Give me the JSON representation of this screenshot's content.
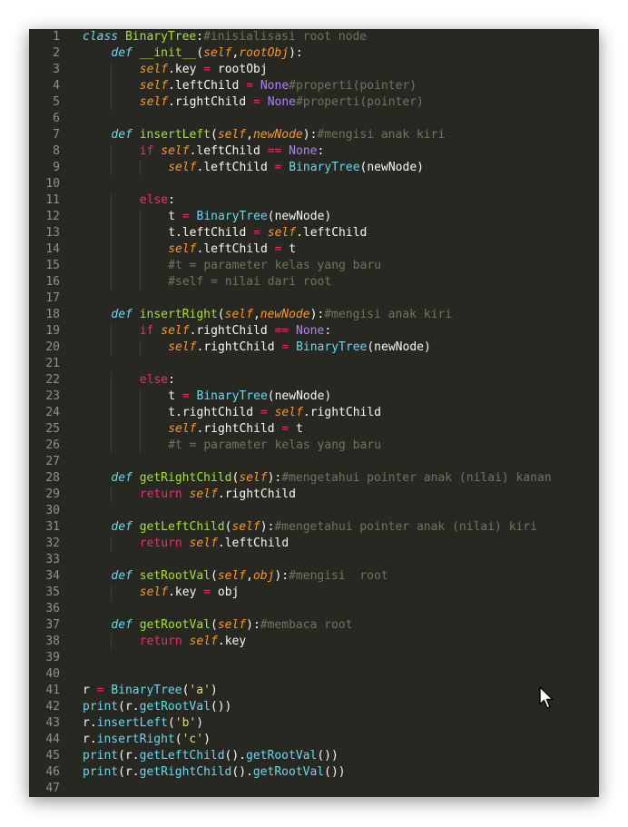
{
  "editor": {
    "theme_colors": {
      "background": "#272822",
      "keyword": "#f92672",
      "function": "#a6e22e",
      "class": "#66d9ef",
      "comment": "#75715e",
      "self": "#fd971f",
      "constant": "#ae81ff",
      "string": "#e6db74",
      "text": "#f8f8f2"
    },
    "lines": [
      {
        "n": "1",
        "indent": 0,
        "tokens": [
          [
            "kw-def",
            "class"
          ],
          [
            "",
            " "
          ],
          [
            "fn",
            "BinaryTree"
          ],
          [
            "",
            ":"
          ],
          [
            "cmt",
            "#inisialisasi root node"
          ]
        ]
      },
      {
        "n": "2",
        "indent": 1,
        "tokens": [
          [
            "kw-def",
            "def"
          ],
          [
            "",
            " "
          ],
          [
            "fn",
            "__init__"
          ],
          [
            "",
            "("
          ],
          [
            "self",
            "self"
          ],
          [
            "",
            ","
          ],
          [
            "param",
            "rootObj"
          ],
          [
            "",
            "):"
          ]
        ]
      },
      {
        "n": "3",
        "indent": 2,
        "tokens": [
          [
            "self",
            "self"
          ],
          [
            "",
            ".key "
          ],
          [
            "op",
            "="
          ],
          [
            "",
            " rootObj"
          ]
        ]
      },
      {
        "n": "4",
        "indent": 2,
        "tokens": [
          [
            "self",
            "self"
          ],
          [
            "",
            ".leftChild "
          ],
          [
            "op",
            "="
          ],
          [
            "",
            " "
          ],
          [
            "const",
            "None"
          ],
          [
            "cmt",
            "#properti(pointer)"
          ]
        ]
      },
      {
        "n": "5",
        "indent": 2,
        "tokens": [
          [
            "self",
            "self"
          ],
          [
            "",
            ".rightChild "
          ],
          [
            "op",
            "="
          ],
          [
            "",
            " "
          ],
          [
            "const",
            "None"
          ],
          [
            "cmt",
            "#properti(pointer)"
          ]
        ]
      },
      {
        "n": "6",
        "indent": 0,
        "tokens": []
      },
      {
        "n": "7",
        "indent": 1,
        "tokens": [
          [
            "kw-def",
            "def"
          ],
          [
            "",
            " "
          ],
          [
            "fn",
            "insertLeft"
          ],
          [
            "",
            "("
          ],
          [
            "self",
            "self"
          ],
          [
            "",
            ","
          ],
          [
            "param",
            "newNode"
          ],
          [
            "",
            "):"
          ],
          [
            "cmt",
            "#mengisi anak kiri"
          ]
        ]
      },
      {
        "n": "8",
        "indent": 2,
        "tokens": [
          [
            "kw",
            "if"
          ],
          [
            "",
            " "
          ],
          [
            "self",
            "self"
          ],
          [
            "",
            ".leftChild "
          ],
          [
            "op",
            "=="
          ],
          [
            "",
            " "
          ],
          [
            "const",
            "None"
          ],
          [
            "",
            ":"
          ]
        ]
      },
      {
        "n": "9",
        "indent": 3,
        "tokens": [
          [
            "self",
            "self"
          ],
          [
            "",
            ".leftChild "
          ],
          [
            "op",
            "="
          ],
          [
            "",
            " "
          ],
          [
            "cls",
            "BinaryTree"
          ],
          [
            "",
            "(newNode)"
          ]
        ]
      },
      {
        "n": "10",
        "indent": 0,
        "tokens": []
      },
      {
        "n": "11",
        "indent": 2,
        "tokens": [
          [
            "kw",
            "else"
          ],
          [
            "",
            ":"
          ]
        ]
      },
      {
        "n": "12",
        "indent": 3,
        "tokens": [
          [
            "",
            "t "
          ],
          [
            "op",
            "="
          ],
          [
            "",
            " "
          ],
          [
            "cls",
            "BinaryTree"
          ],
          [
            "",
            "(newNode)"
          ]
        ]
      },
      {
        "n": "13",
        "indent": 3,
        "tokens": [
          [
            "",
            "t.leftChild "
          ],
          [
            "op",
            "="
          ],
          [
            "",
            " "
          ],
          [
            "self",
            "self"
          ],
          [
            "",
            ".leftChild"
          ]
        ]
      },
      {
        "n": "14",
        "indent": 3,
        "tokens": [
          [
            "self",
            "self"
          ],
          [
            "",
            ".leftChild "
          ],
          [
            "op",
            "="
          ],
          [
            "",
            " t"
          ]
        ]
      },
      {
        "n": "15",
        "indent": 3,
        "tokens": [
          [
            "cmt",
            "#t = parameter kelas yang baru"
          ]
        ]
      },
      {
        "n": "16",
        "indent": 3,
        "tokens": [
          [
            "cmt",
            "#self = nilai dari root"
          ]
        ]
      },
      {
        "n": "17",
        "indent": 0,
        "tokens": []
      },
      {
        "n": "18",
        "indent": 1,
        "tokens": [
          [
            "kw-def",
            "def"
          ],
          [
            "",
            " "
          ],
          [
            "fn",
            "insertRight"
          ],
          [
            "",
            "("
          ],
          [
            "self",
            "self"
          ],
          [
            "",
            ","
          ],
          [
            "param",
            "newNode"
          ],
          [
            "",
            "):"
          ],
          [
            "cmt",
            "#mengisi anak kiri"
          ]
        ]
      },
      {
        "n": "19",
        "indent": 2,
        "tokens": [
          [
            "kw",
            "if"
          ],
          [
            "",
            " "
          ],
          [
            "self",
            "self"
          ],
          [
            "",
            ".rightChild "
          ],
          [
            "op",
            "=="
          ],
          [
            "",
            " "
          ],
          [
            "const",
            "None"
          ],
          [
            "",
            ":"
          ]
        ]
      },
      {
        "n": "20",
        "indent": 3,
        "tokens": [
          [
            "self",
            "self"
          ],
          [
            "",
            ".rightChild "
          ],
          [
            "op",
            "="
          ],
          [
            "",
            " "
          ],
          [
            "cls",
            "BinaryTree"
          ],
          [
            "",
            "(newNode)"
          ]
        ]
      },
      {
        "n": "21",
        "indent": 0,
        "tokens": []
      },
      {
        "n": "22",
        "indent": 2,
        "tokens": [
          [
            "kw",
            "else"
          ],
          [
            "",
            ":"
          ]
        ]
      },
      {
        "n": "23",
        "indent": 3,
        "tokens": [
          [
            "",
            "t "
          ],
          [
            "op",
            "="
          ],
          [
            "",
            " "
          ],
          [
            "cls",
            "BinaryTree"
          ],
          [
            "",
            "(newNode)"
          ]
        ]
      },
      {
        "n": "24",
        "indent": 3,
        "tokens": [
          [
            "",
            "t.rightChild "
          ],
          [
            "op",
            "="
          ],
          [
            "",
            " "
          ],
          [
            "self",
            "self"
          ],
          [
            "",
            ".rightChild"
          ]
        ]
      },
      {
        "n": "25",
        "indent": 3,
        "tokens": [
          [
            "self",
            "self"
          ],
          [
            "",
            ".rightChild "
          ],
          [
            "op",
            "="
          ],
          [
            "",
            " t"
          ]
        ]
      },
      {
        "n": "26",
        "indent": 3,
        "tokens": [
          [
            "cmt",
            "#t = parameter kelas yang baru"
          ]
        ]
      },
      {
        "n": "27",
        "indent": 0,
        "tokens": []
      },
      {
        "n": "28",
        "indent": 1,
        "tokens": [
          [
            "kw-def",
            "def"
          ],
          [
            "",
            " "
          ],
          [
            "fn",
            "getRightChild"
          ],
          [
            "",
            "("
          ],
          [
            "self",
            "self"
          ],
          [
            "",
            "):"
          ],
          [
            "cmt",
            "#mengetahui pointer anak (nilai) kanan"
          ]
        ]
      },
      {
        "n": "29",
        "indent": 2,
        "tokens": [
          [
            "kw",
            "return"
          ],
          [
            "",
            " "
          ],
          [
            "self",
            "self"
          ],
          [
            "",
            ".rightChild"
          ]
        ]
      },
      {
        "n": "30",
        "indent": 0,
        "tokens": []
      },
      {
        "n": "31",
        "indent": 1,
        "tokens": [
          [
            "kw-def",
            "def"
          ],
          [
            "",
            " "
          ],
          [
            "fn",
            "getLeftChild"
          ],
          [
            "",
            "("
          ],
          [
            "self",
            "self"
          ],
          [
            "",
            "):"
          ],
          [
            "cmt",
            "#mengetahui pointer anak (nilai) kiri"
          ]
        ]
      },
      {
        "n": "32",
        "indent": 2,
        "tokens": [
          [
            "kw",
            "return"
          ],
          [
            "",
            " "
          ],
          [
            "self",
            "self"
          ],
          [
            "",
            ".leftChild"
          ]
        ]
      },
      {
        "n": "33",
        "indent": 0,
        "tokens": []
      },
      {
        "n": "34",
        "indent": 1,
        "tokens": [
          [
            "kw-def",
            "def"
          ],
          [
            "",
            " "
          ],
          [
            "fn",
            "setRootVal"
          ],
          [
            "",
            "("
          ],
          [
            "self",
            "self"
          ],
          [
            "",
            ","
          ],
          [
            "param",
            "obj"
          ],
          [
            "",
            "):"
          ],
          [
            "cmt",
            "#mengisi  root"
          ]
        ]
      },
      {
        "n": "35",
        "indent": 2,
        "tokens": [
          [
            "self",
            "self"
          ],
          [
            "",
            ".key "
          ],
          [
            "op",
            "="
          ],
          [
            "",
            " obj"
          ]
        ]
      },
      {
        "n": "36",
        "indent": 0,
        "tokens": []
      },
      {
        "n": "37",
        "indent": 1,
        "tokens": [
          [
            "kw-def",
            "def"
          ],
          [
            "",
            " "
          ],
          [
            "fn",
            "getRootVal"
          ],
          [
            "",
            "("
          ],
          [
            "self",
            "self"
          ],
          [
            "",
            "):"
          ],
          [
            "cmt",
            "#membaca root"
          ]
        ]
      },
      {
        "n": "38",
        "indent": 2,
        "tokens": [
          [
            "kw",
            "return"
          ],
          [
            "",
            " "
          ],
          [
            "self",
            "self"
          ],
          [
            "",
            ".key"
          ]
        ]
      },
      {
        "n": "39",
        "indent": 0,
        "tokens": []
      },
      {
        "n": "40",
        "indent": 0,
        "tokens": []
      },
      {
        "n": "41",
        "indent": 0,
        "tokens": [
          [
            "",
            "r "
          ],
          [
            "op",
            "="
          ],
          [
            "",
            " "
          ],
          [
            "cls",
            "BinaryTree"
          ],
          [
            "",
            "("
          ],
          [
            "str",
            "'a'"
          ],
          [
            "",
            ")"
          ]
        ]
      },
      {
        "n": "42",
        "indent": 0,
        "tokens": [
          [
            "cls",
            "print"
          ],
          [
            "",
            "(r."
          ],
          [
            "cls",
            "getRootVal"
          ],
          [
            "",
            "())"
          ]
        ]
      },
      {
        "n": "43",
        "indent": 0,
        "tokens": [
          [
            "",
            "r."
          ],
          [
            "cls",
            "insertLeft"
          ],
          [
            "",
            "("
          ],
          [
            "str",
            "'b'"
          ],
          [
            "",
            ")"
          ]
        ]
      },
      {
        "n": "44",
        "indent": 0,
        "tokens": [
          [
            "",
            "r."
          ],
          [
            "cls",
            "insertRight"
          ],
          [
            "",
            "("
          ],
          [
            "str",
            "'c'"
          ],
          [
            "",
            ")"
          ]
        ]
      },
      {
        "n": "45",
        "indent": 0,
        "tokens": [
          [
            "cls",
            "print"
          ],
          [
            "",
            "(r."
          ],
          [
            "cls",
            "getLeftChild"
          ],
          [
            "",
            "()."
          ],
          [
            "cls",
            "getRootVal"
          ],
          [
            "",
            "())"
          ]
        ]
      },
      {
        "n": "46",
        "indent": 0,
        "tokens": [
          [
            "cls",
            "print"
          ],
          [
            "",
            "(r."
          ],
          [
            "cls",
            "getRightChild"
          ],
          [
            "",
            "()."
          ],
          [
            "cls",
            "getRootVal"
          ],
          [
            "",
            "())"
          ]
        ]
      },
      {
        "n": "47",
        "indent": 0,
        "tokens": []
      }
    ]
  },
  "cursor": {
    "icon": "mouse-pointer-icon"
  }
}
